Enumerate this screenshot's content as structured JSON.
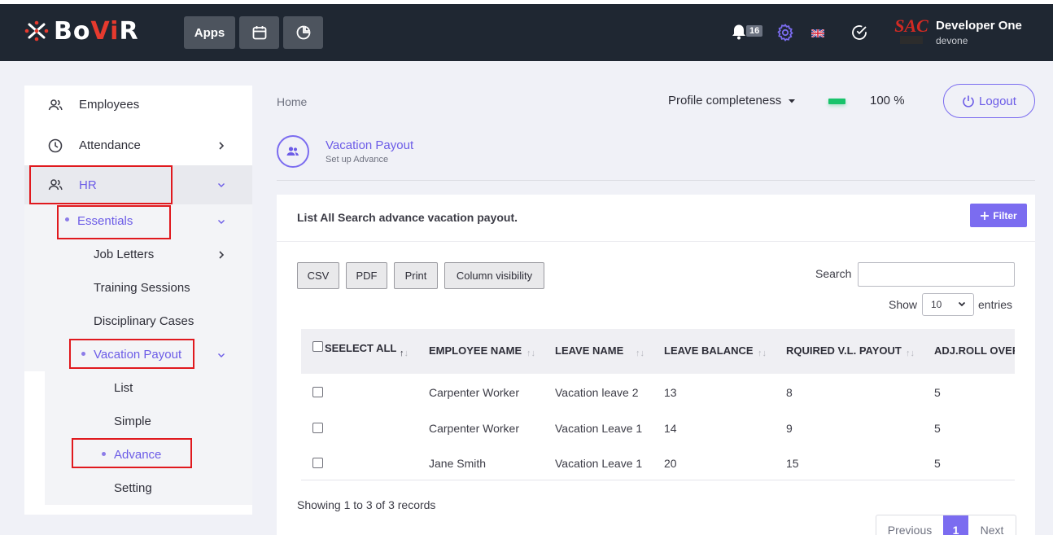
{
  "header": {
    "logo_prefix": "Bo",
    "logo_accent": "Vi",
    "logo_suffix": "R",
    "apps_label": "Apps",
    "notification_count": "16",
    "avatar_text": "SAC",
    "user_name": "Developer One",
    "user_id": "devone"
  },
  "sidebar": {
    "employees": "Employees",
    "attendance": "Attendance",
    "hr": "HR",
    "essentials": "Essentials",
    "job_letters": "Job Letters",
    "training_sessions": "Training Sessions",
    "disciplinary_cases": "Disciplinary Cases",
    "vacation_payout": "Vacation Payout",
    "list": "List",
    "simple": "Simple",
    "advance": "Advance",
    "setting": "Setting"
  },
  "breadcrumb": "Home",
  "profile": {
    "label": "Profile completeness",
    "percent": "100 %",
    "progress": 1.0
  },
  "logout_label": "Logout",
  "page": {
    "title": "Vacation Payout",
    "subtitle": "Set up Advance"
  },
  "card": {
    "title": "List All Search advance vacation payout.",
    "filter_label": "Filter"
  },
  "toolbar": {
    "csv": "CSV",
    "pdf": "PDF",
    "print": "Print",
    "column_visibility": "Column visibility",
    "search_label": "Search",
    "show_label": "Show",
    "show_value": "10",
    "entries_label": "entries"
  },
  "table": {
    "select_all": "SEELECT ALL",
    "columns": [
      "EMPLOYEE NAME",
      "LEAVE NAME",
      "LEAVE BALANCE",
      "RQUIRED V.L. PAYOUT",
      "ADJ.ROLL OVER"
    ],
    "rows": [
      [
        "Carpenter Worker",
        "Vacation leave 2",
        "13",
        "8",
        "5"
      ],
      [
        "Carpenter Worker",
        "Vacation Leave 1",
        "14",
        "9",
        "5"
      ],
      [
        "Jane Smith",
        "Vacation Leave 1",
        "20",
        "15",
        "5"
      ]
    ]
  },
  "footer": {
    "info": "Showing 1 to 3 of 3 records",
    "previous": "Previous",
    "page": "1",
    "next": "Next"
  },
  "colors": {
    "accent": "#6c5ce7",
    "topbar": "#1f2732",
    "highlight": "#e0191e",
    "progress": "#19c36b"
  }
}
